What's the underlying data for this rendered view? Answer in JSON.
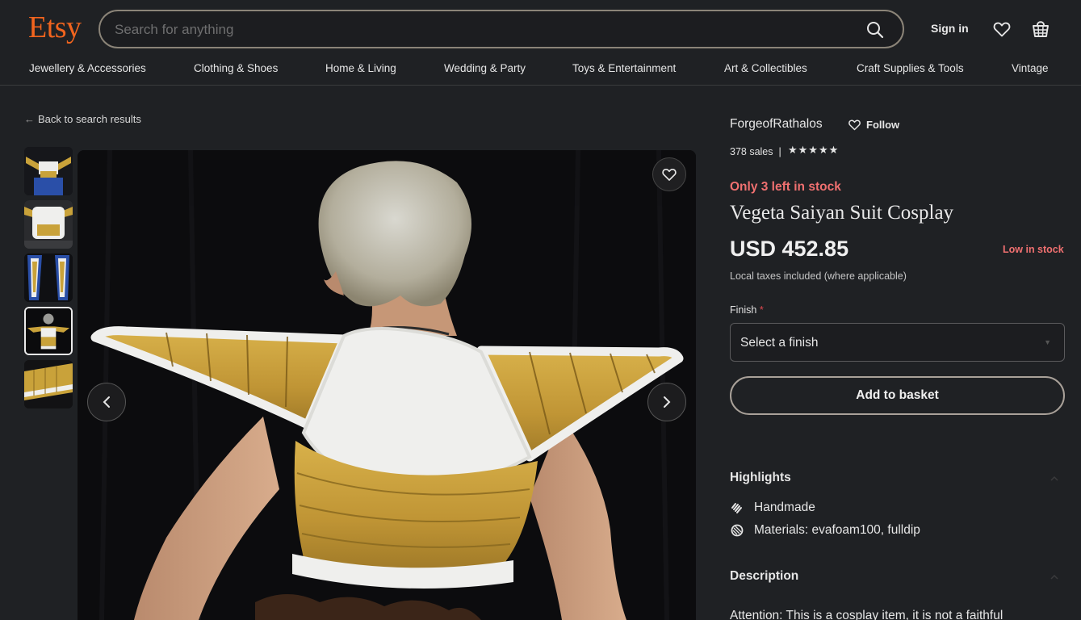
{
  "header": {
    "logo": "Etsy",
    "search_placeholder": "Search for anything",
    "signin": "Sign in"
  },
  "nav": [
    "Jewellery & Accessories",
    "Clothing & Shoes",
    "Home & Living",
    "Wedding & Party",
    "Toys & Entertainment",
    "Art & Collectibles",
    "Craft Supplies & Tools",
    "Vintage"
  ],
  "back_link": "Back to search results",
  "listing": {
    "shop_name": "ForgeofRathalos",
    "follow": "Follow",
    "sales": "378 sales",
    "rating_stars": 5,
    "stock_notice": "Only 3 left in stock",
    "title": "Vegeta Saiyan Suit Cosplay",
    "price": "USD 452.85",
    "low_stock": "Low in stock",
    "taxes": "Local taxes included (where applicable)",
    "finish_label": "Finish",
    "finish_required": "*",
    "finish_select": "Select a finish",
    "add_to_basket": "Add to basket"
  },
  "highlights": {
    "title": "Highlights",
    "items": [
      "Handmade",
      "Materials: evafoam100, fulldip"
    ]
  },
  "description": {
    "title": "Description",
    "text": "Attention: This is a cosplay item, it is not a faithful"
  },
  "colors": {
    "brand": "#f1641e",
    "background": "#1f2124",
    "alert": "#f07070",
    "armor_gold": "#c9a23a",
    "armor_white": "#f2f2f0"
  }
}
